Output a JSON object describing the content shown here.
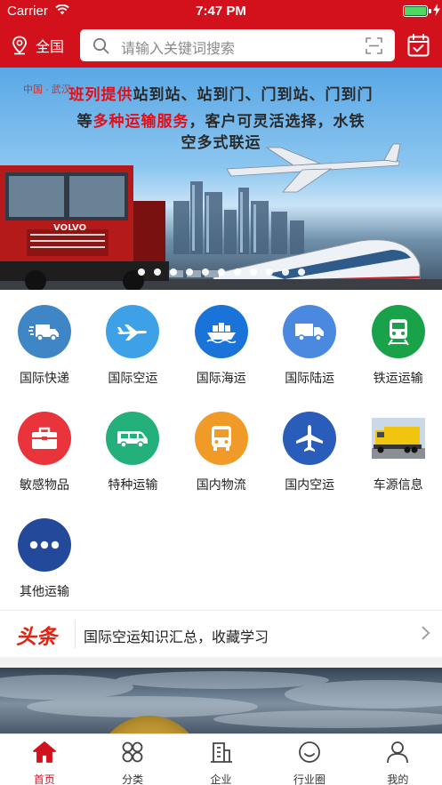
{
  "status": {
    "carrier": "Carrier",
    "time": "7:47 PM",
    "battery_level": 1.0
  },
  "header": {
    "location_label": "全国",
    "search_placeholder": "请输入关键词搜索",
    "accent": "#d3111c"
  },
  "banner": {
    "tiny_text": "中国 · 武汉",
    "line1_highlight": "班列提供",
    "line1_rest": "站到站、站到门、门到站、门到门",
    "line2_pre": "等",
    "line2_highlight": "多种运输服务",
    "line2_rest": "，客户可灵活选择，水铁",
    "line3": "空多式联运",
    "slide_count": 11
  },
  "categories": [
    {
      "label": "国际快递",
      "icon": "express-truck-icon",
      "color": "#3e86c6"
    },
    {
      "label": "国际空运",
      "icon": "airplane-icon",
      "color": "#3ea1e8"
    },
    {
      "label": "国际海运",
      "icon": "ship-icon",
      "color": "#1a73d9"
    },
    {
      "label": "国际陆运",
      "icon": "truck-icon",
      "color": "#4b88e0"
    },
    {
      "label": "铁运运输",
      "icon": "train-icon",
      "color": "#1aa24a"
    },
    {
      "label": "敏感物品",
      "icon": "briefcase-icon",
      "color": "#e8343a"
    },
    {
      "label": "特种运输",
      "icon": "van-icon",
      "color": "#24b07a"
    },
    {
      "label": "国内物流",
      "icon": "bus-icon",
      "color": "#f09a27"
    },
    {
      "label": "国内空运",
      "icon": "jet-icon",
      "color": "#2a5db9"
    },
    {
      "label": "车源信息",
      "icon": "truck-photo-icon",
      "color": "#c9d6e2"
    },
    {
      "label": "其他运输",
      "icon": "more-icon",
      "color": "#234a9a"
    }
  ],
  "headline": {
    "tag": "头条",
    "text": "国际空运知识汇总，收藏学习",
    "tag_color": "#e8210f"
  },
  "tabs": [
    {
      "label": "首页",
      "icon": "home-icon",
      "active": true
    },
    {
      "label": "分类",
      "icon": "category-icon",
      "active": false
    },
    {
      "label": "企业",
      "icon": "building-icon",
      "active": false
    },
    {
      "label": "行业圈",
      "icon": "smile-icon",
      "active": false
    },
    {
      "label": "我的",
      "icon": "person-icon",
      "active": false
    }
  ]
}
